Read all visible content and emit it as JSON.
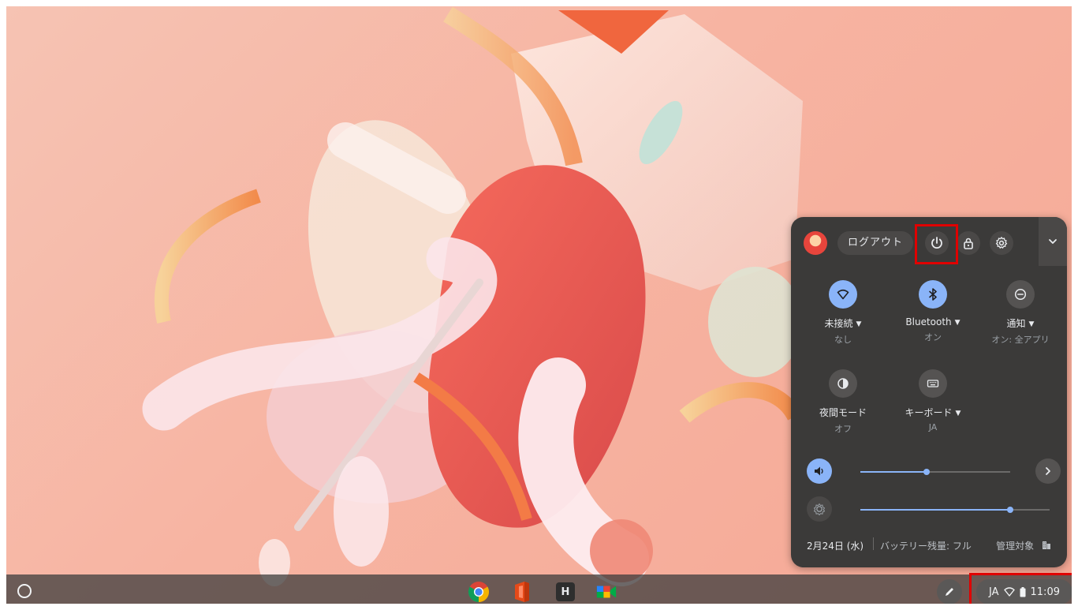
{
  "quick_settings": {
    "logout_label": "ログアウト",
    "icons": {
      "power": "power-icon",
      "lock": "lock-icon",
      "settings": "gear-icon",
      "collapse": "chevron-down-icon"
    },
    "tiles": [
      {
        "label": "未接続",
        "sub": "なし",
        "icon": "wifi-icon",
        "active": true
      },
      {
        "label": "Bluetooth",
        "sub": "オン",
        "icon": "bluetooth-icon",
        "active": true
      },
      {
        "label": "通知",
        "sub": "オン: 全アプリ",
        "icon": "do-not-disturb-icon",
        "active": false
      },
      {
        "label": "夜間モード",
        "sub": "オフ",
        "icon": "night-light-icon",
        "active": false
      },
      {
        "label": "キーボード",
        "sub": "JA",
        "icon": "keyboard-icon",
        "active": false
      }
    ],
    "volume_level": 0.44,
    "brightness_level": 0.79,
    "footer": {
      "date": "2月24日 (水)",
      "battery": "バッテリー残量: フル",
      "managed": "管理対象"
    }
  },
  "shelf": {
    "apps": [
      "chrome-icon",
      "office-icon",
      "h-app-icon",
      "meet-icon"
    ],
    "h_app_letter": "H",
    "status": {
      "ime": "JA",
      "time": "11:09"
    }
  },
  "colors": {
    "accent": "#8ab4f8",
    "bubble_bg": "#3b3a39",
    "highlight": "#e00000"
  }
}
